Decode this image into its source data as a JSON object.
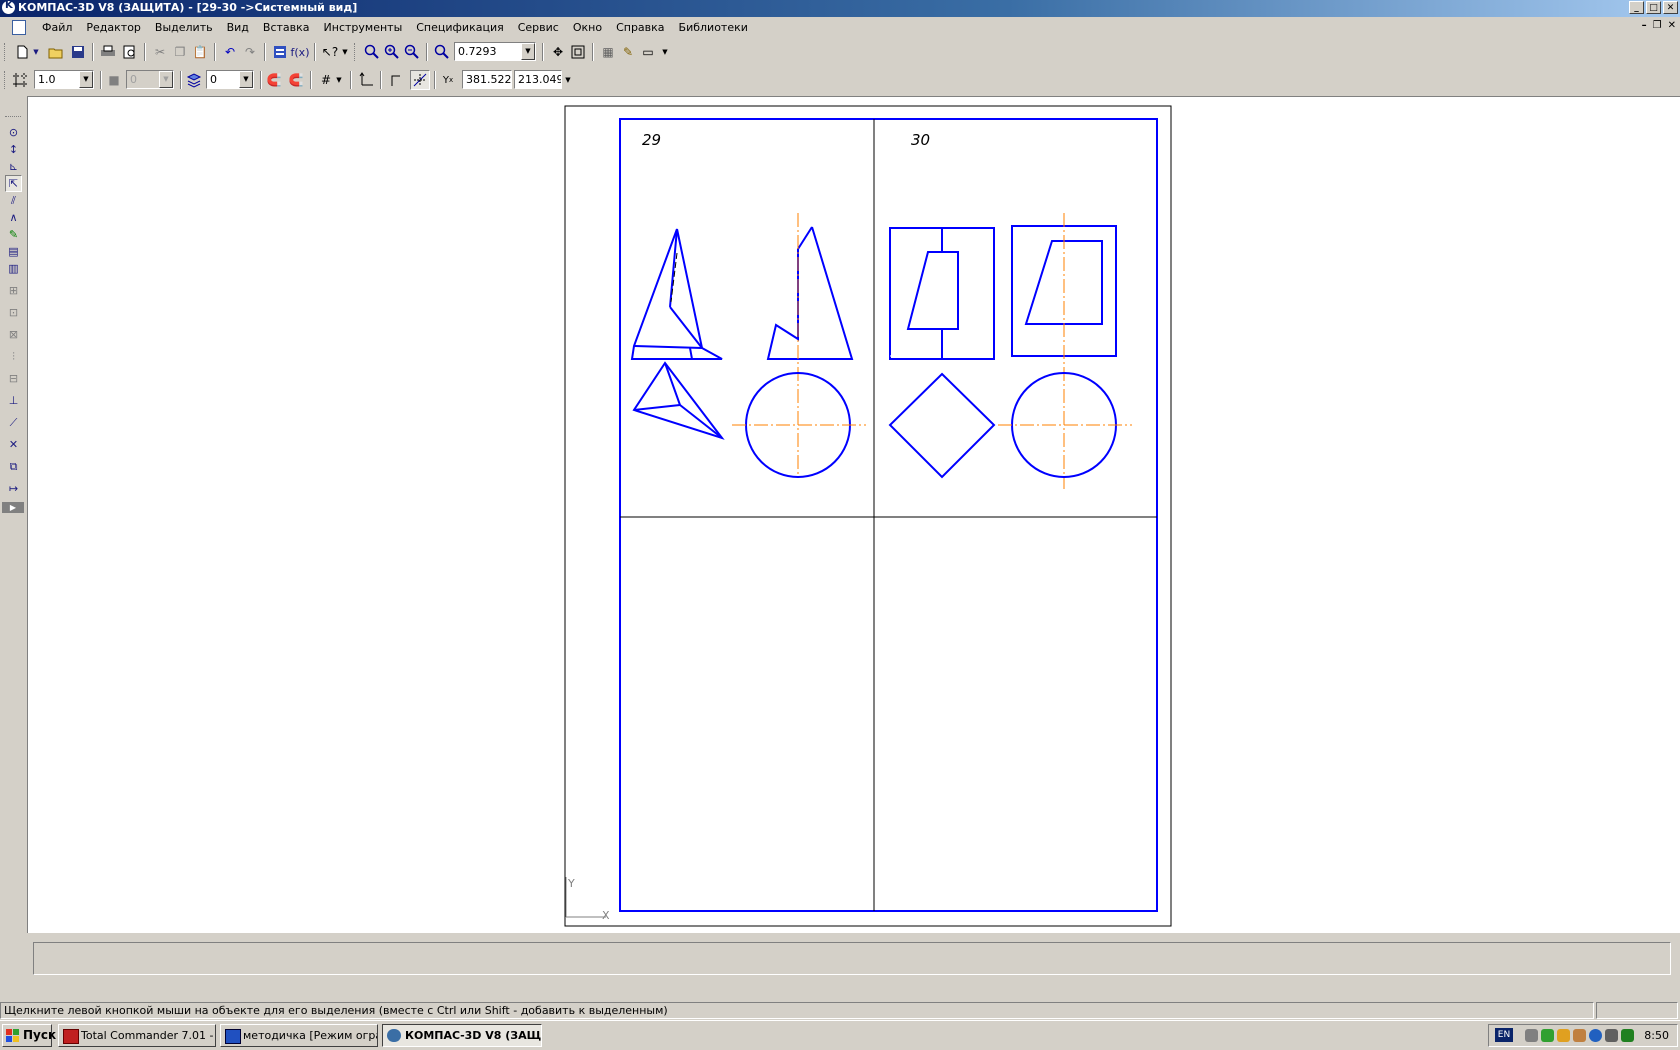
{
  "window": {
    "title": "КОМПАС-3D V8 (ЗАЩИТА) - [29-30 ->Системный вид]",
    "btn_minimize": "_",
    "btn_maximize": "□",
    "btn_close": "✕",
    "mdi_minimize": "–",
    "mdi_restore": "❐",
    "mdi_close": "✕"
  },
  "menu": {
    "items": [
      "Файл",
      "Редактор",
      "Выделить",
      "Вид",
      "Вставка",
      "Инструменты",
      "Спецификация",
      "Сервис",
      "Окно",
      "Справка",
      "Библиотеки"
    ]
  },
  "toolbar1": {
    "zoom_value": "0.7293"
  },
  "toolbar2": {
    "step_value": "1.0",
    "style_value": "0",
    "layer_value": "0",
    "coord_x": "381.522",
    "coord_y": "213.049",
    "coord_label": "Y"
  },
  "drawing": {
    "cell_label_left": "29",
    "cell_label_right": "30",
    "axis_y_label": "Y",
    "axis_x_label": "X"
  },
  "status": {
    "hint": "Щелкните левой кнопкой мыши на объекте для его выделения (вместе с Ctrl или Shift - добавить к выделенным)"
  },
  "taskbar": {
    "start_label": "Пуск",
    "tasks": [
      {
        "label": "Total Commander 7.01 - ..."
      },
      {
        "label": "методичка [Режим огра..."
      },
      {
        "label": "КОМПАС-3D V8 (ЗАЩ..."
      }
    ],
    "lang": "EN",
    "clock": "8:50"
  },
  "colors": {
    "geometry": "#0000ff",
    "axis": "#ff8000",
    "frame": "#000000"
  }
}
